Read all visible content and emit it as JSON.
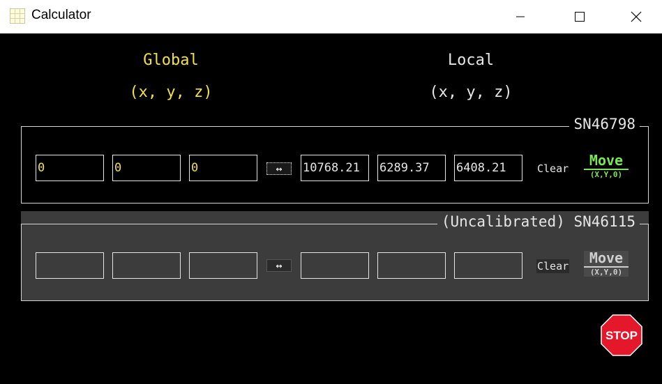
{
  "window": {
    "title": "Calculator"
  },
  "headers": {
    "global": {
      "label": "Global",
      "coords": "(x, y, z)"
    },
    "local": {
      "label": "Local",
      "coords": "(x, y, z)"
    }
  },
  "devices": [
    {
      "legend": "SN46798",
      "global_values": [
        "0",
        "0",
        "0"
      ],
      "local_values": [
        "10768.21",
        "6289.37",
        "6408.21"
      ],
      "swap_label": "↔",
      "clear_label": "Clear",
      "move_label": "Move",
      "move_sub": "(X,Y,0)"
    },
    {
      "legend": "(Uncalibrated) SN46115",
      "global_values": [
        "",
        "",
        ""
      ],
      "local_values": [
        "",
        "",
        ""
      ],
      "swap_label": "↔",
      "clear_label": "Clear",
      "move_label": "Move",
      "move_sub": "(X,Y,0)"
    }
  ],
  "stop": {
    "label": "STOP"
  },
  "colors": {
    "global": "#f2e244",
    "move_active": "#7de35a",
    "stop": "#e5172a"
  }
}
